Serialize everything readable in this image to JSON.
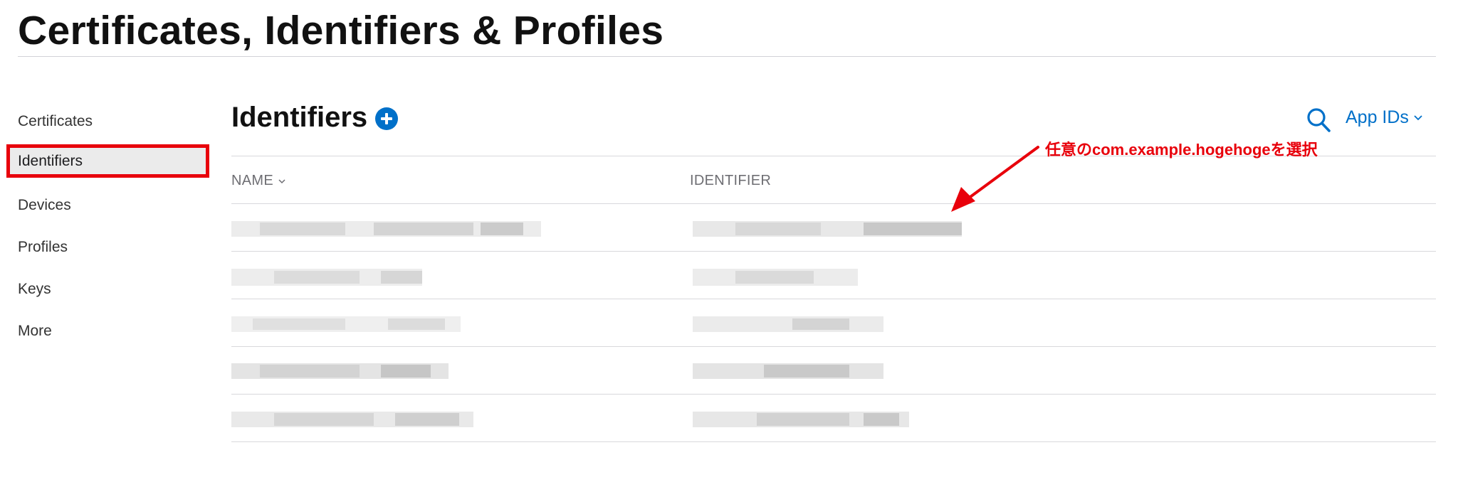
{
  "page": {
    "title": "Certificates, Identifiers & Profiles"
  },
  "sidebar": {
    "items": [
      {
        "label": "Certificates",
        "active": false
      },
      {
        "label": "Identifiers",
        "active": true
      },
      {
        "label": "Devices",
        "active": false
      },
      {
        "label": "Profiles",
        "active": false
      },
      {
        "label": "Keys",
        "active": false
      },
      {
        "label": "More",
        "active": false
      }
    ]
  },
  "main": {
    "title": "Identifiers",
    "add_icon": "plus-circle-icon",
    "search_icon": "search-icon",
    "filter": {
      "selected": "App IDs",
      "icon": "chevron-down-icon"
    },
    "table": {
      "columns": [
        {
          "label": "NAME",
          "sortable": true
        },
        {
          "label": "IDENTIFIER",
          "sortable": false
        }
      ],
      "rows_note": "cell contents are pixelated / blurred out in the screenshot"
    },
    "annotation": {
      "text": "任意のcom.example.hogehogeを選択",
      "color": "#e8000b"
    }
  },
  "colors": {
    "accent": "#0070c9",
    "highlight_border": "#e8000b",
    "active_item_bg": "#ebebeb",
    "divider": "#d8d8dc"
  }
}
